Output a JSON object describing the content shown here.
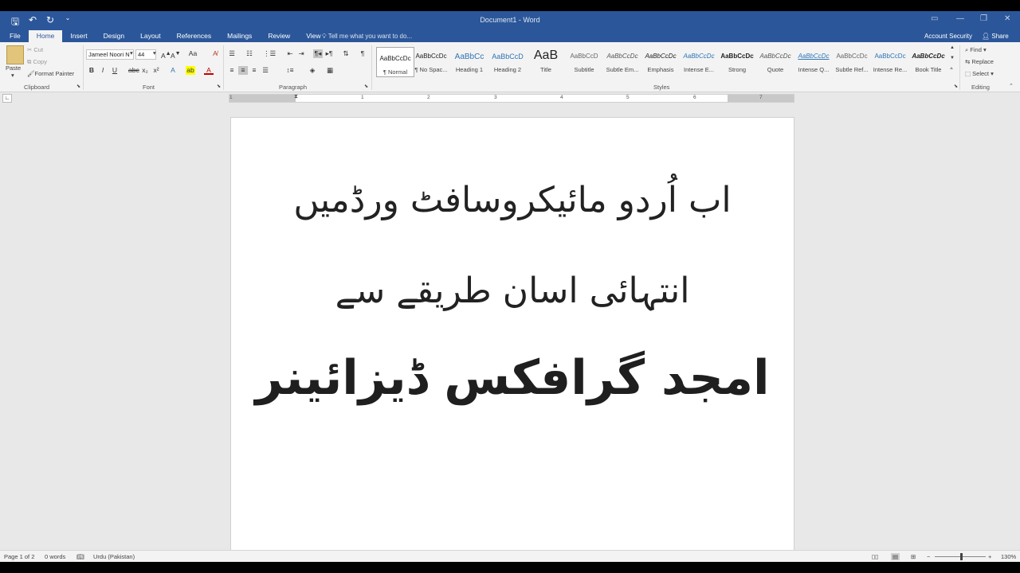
{
  "window": {
    "title": "Document1 - Word",
    "account": "Account Security",
    "share": "Share"
  },
  "tabs": [
    {
      "label": "File"
    },
    {
      "label": "Home",
      "active": true
    },
    {
      "label": "Insert"
    },
    {
      "label": "Design"
    },
    {
      "label": "Layout"
    },
    {
      "label": "References"
    },
    {
      "label": "Mailings"
    },
    {
      "label": "Review"
    },
    {
      "label": "View"
    }
  ],
  "tell_me": "Tell me what you want to do...",
  "clipboard": {
    "paste": "Paste",
    "cut": "Cut",
    "copy": "Copy",
    "format_painter": "Format Painter",
    "group": "Clipboard"
  },
  "font": {
    "name": "Jameel Noori N",
    "size": "44",
    "group": "Font"
  },
  "paragraph": {
    "group": "Paragraph"
  },
  "styles": {
    "group": "Styles",
    "items": [
      {
        "sample": "AaBbCcDc",
        "name": "¶ Normal",
        "active": true
      },
      {
        "sample": "AaBbCcDc",
        "name": "¶ No Spac..."
      },
      {
        "sample": "AaBbCc",
        "name": "Heading 1",
        "color": "#2e74b5"
      },
      {
        "sample": "AaBbCcD",
        "name": "Heading 2",
        "color": "#2e74b5"
      },
      {
        "sample": "AaB",
        "name": "Title"
      },
      {
        "sample": "AaBbCcD",
        "name": "Subtitle",
        "color": "#666666"
      },
      {
        "sample": "AaBbCcDc",
        "name": "Subtle Em..."
      },
      {
        "sample": "AaBbCcDc",
        "name": "Emphasis"
      },
      {
        "sample": "AaBbCcDc",
        "name": "Intense E...",
        "color": "#2e74b5"
      },
      {
        "sample": "AaBbCcDc",
        "name": "Strong"
      },
      {
        "sample": "AaBbCcDc",
        "name": "Quote"
      },
      {
        "sample": "AaBbCcDc",
        "name": "Intense Q...",
        "color": "#2e74b5"
      },
      {
        "sample": "AaBbCcDc",
        "name": "Subtle Ref..."
      },
      {
        "sample": "AaBbCcDc",
        "name": "Intense Re...",
        "color": "#2e74b5"
      },
      {
        "sample": "AaBbCcDc",
        "name": "Book Title"
      }
    ]
  },
  "editing": {
    "find": "Find",
    "replace": "Replace",
    "select": "Select",
    "group": "Editing"
  },
  "ruler_numbers": [
    "1",
    "1",
    "2",
    "3",
    "4",
    "5",
    "6",
    "7"
  ],
  "document": {
    "line1": "اب اُردو مائیکروسافٹ ورڈمیں",
    "line2": "انتہائی اسان طریقے سے",
    "line3": "امجد گرافکس ڈیزائینر"
  },
  "status": {
    "page": "Page 1 of 2",
    "words": "0 words",
    "language": "Urdu (Pakistan)",
    "zoom": "130%"
  },
  "zoom_level": 1.3
}
